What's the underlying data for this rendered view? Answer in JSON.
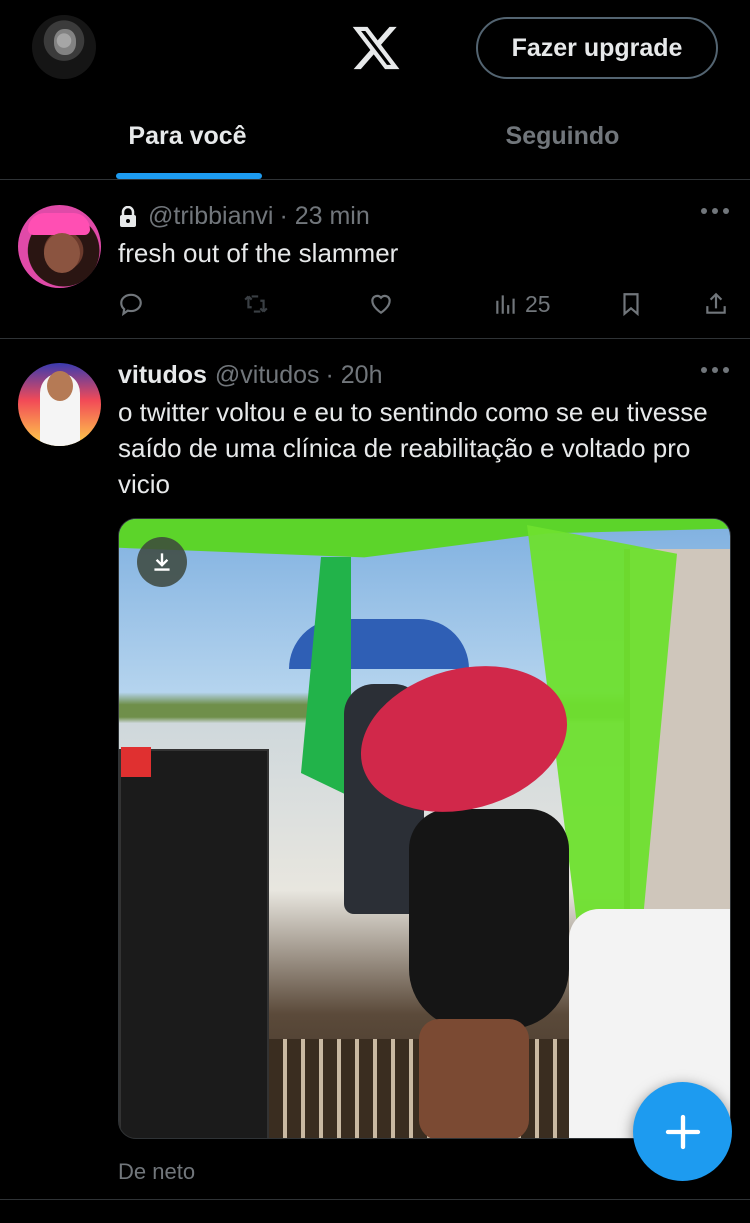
{
  "header": {
    "upgrade_label": "Fazer upgrade",
    "tabs": [
      {
        "label": "Para você",
        "active": true
      },
      {
        "label": "Seguindo",
        "active": false
      }
    ]
  },
  "tweets": [
    {
      "display_name": "",
      "handle": "@tribbianvi",
      "time": "· 23 min",
      "protected": true,
      "text": "fresh out of the slammer",
      "views": "25"
    },
    {
      "display_name": "vitudos",
      "handle": "@vitudos",
      "time": "· 20h",
      "text": "o twitter voltou e eu to sentindo como se eu tivesse saído de uma clínica de reabilitação e voltado pro vicio",
      "byline": "De neto"
    }
  ],
  "icons": {
    "logo": "x-logo-icon",
    "lock": "lock-icon",
    "more": "more-icon",
    "reply": "reply-icon",
    "retweet": "retweet-icon",
    "like": "like-icon",
    "views": "views-icon",
    "bookmark": "bookmark-icon",
    "share": "share-icon",
    "download": "download-icon",
    "compose": "plus-icon"
  },
  "colors": {
    "accent": "#1d9bf0",
    "background": "#000000",
    "muted": "#71767b",
    "text": "#e7e9ea",
    "divider": "#2f3336"
  }
}
